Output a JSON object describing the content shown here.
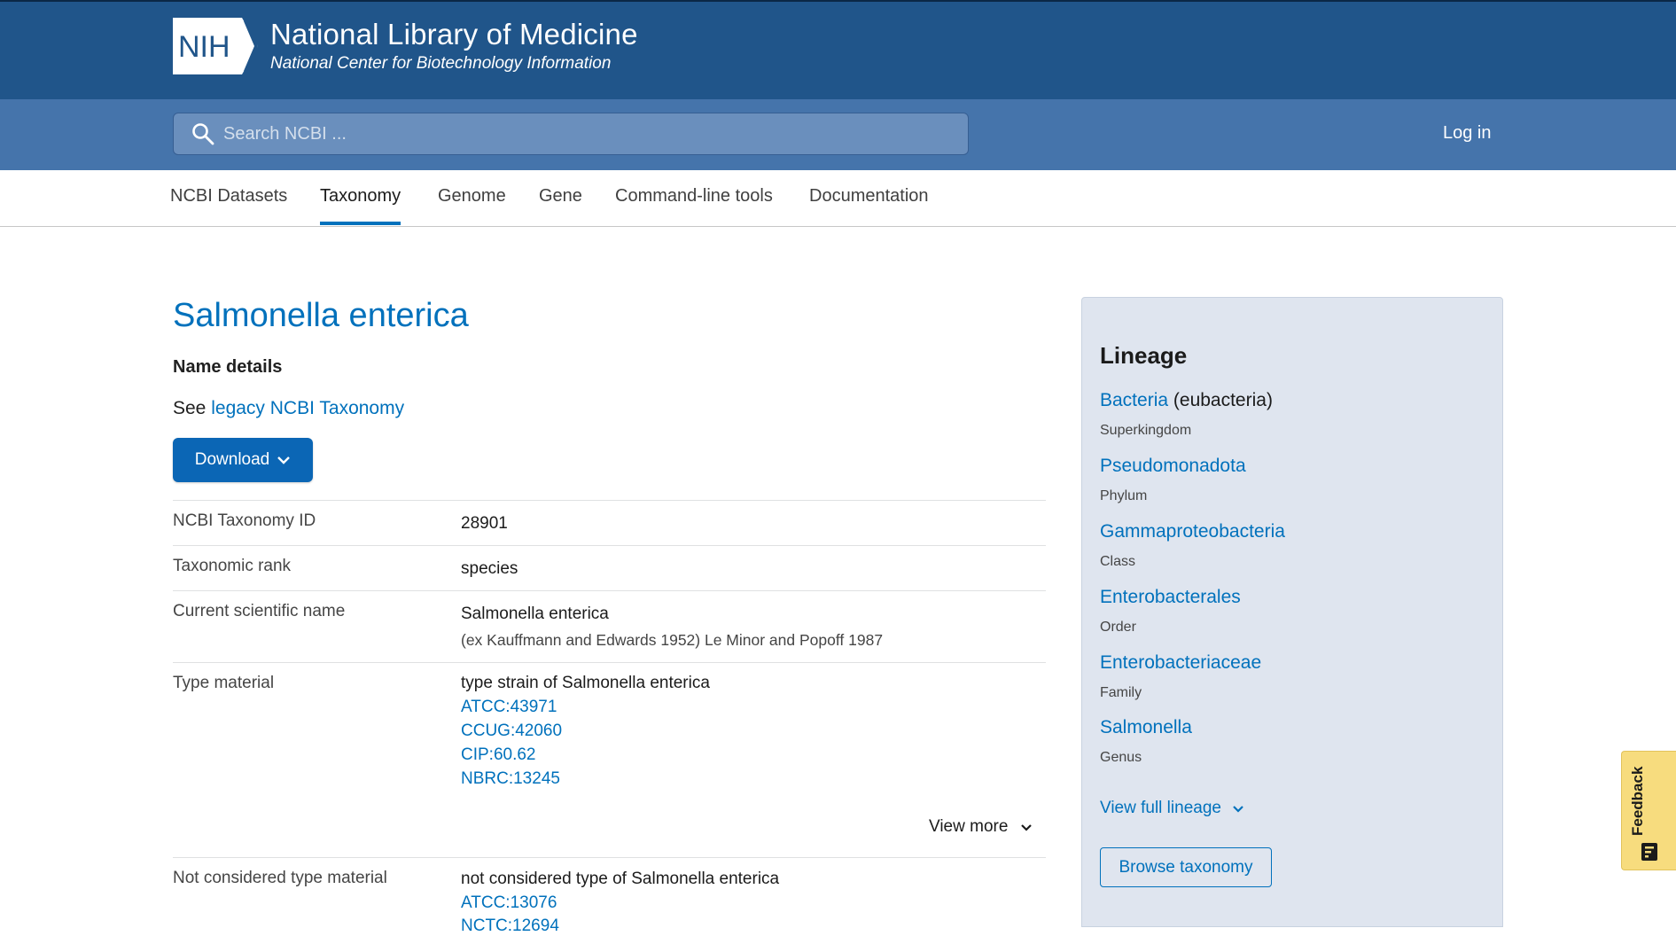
{
  "header": {
    "logo_text": "NIH",
    "title": "National Library of Medicine",
    "subtitle": "National Center for Biotechnology Information",
    "login_label": "Log in"
  },
  "search": {
    "placeholder": "Search NCBI ..."
  },
  "tabs": [
    {
      "label": "NCBI Datasets",
      "active": false
    },
    {
      "label": "Taxonomy",
      "active": true
    },
    {
      "label": "Genome",
      "active": false
    },
    {
      "label": "Gene",
      "active": false
    },
    {
      "label": "Command-line tools",
      "active": false
    },
    {
      "label": "Documentation",
      "active": false
    }
  ],
  "main": {
    "title": "Salmonella enterica",
    "name_details_heading": "Name details",
    "see_prefix": "See",
    "legacy_link": "legacy NCBI Taxonomy",
    "download_label": "Download",
    "details": {
      "taxonomy_id": {
        "label": "NCBI Taxonomy ID",
        "value": "28901"
      },
      "rank": {
        "label": "Taxonomic rank",
        "value": "species"
      },
      "scientific_name": {
        "label": "Current scientific name",
        "value": "Salmonella enterica",
        "authority": "(ex Kauffmann and Edwards 1952) Le Minor and Popoff 1987"
      },
      "type_material": {
        "label": "Type material",
        "value": "type strain of Salmonella enterica",
        "links": [
          "ATCC:43971",
          "CCUG:42060",
          "CIP:60.62",
          "NBRC:13245"
        ]
      },
      "view_more_label": "View more",
      "not_type_material": {
        "label": "Not considered type material",
        "value": "not considered type of Salmonella enterica",
        "links": [
          "ATCC:13076",
          "NCTC:12694"
        ]
      }
    }
  },
  "lineage": {
    "heading": "Lineage",
    "items": [
      {
        "name": "Bacteria",
        "common": "(eubacteria)",
        "rank": "Superkingdom"
      },
      {
        "name": "Pseudomonadota",
        "common": "",
        "rank": "Phylum"
      },
      {
        "name": "Gammaproteobacteria",
        "common": "",
        "rank": "Class"
      },
      {
        "name": "Enterobacterales",
        "common": "",
        "rank": "Order"
      },
      {
        "name": "Enterobacteriaceae",
        "common": "",
        "rank": "Family"
      },
      {
        "name": "Salmonella",
        "common": "",
        "rank": "Genus"
      }
    ],
    "view_full_label": "View full lineage",
    "browse_label": "Browse taxonomy"
  },
  "feedback": {
    "label": "Feedback"
  },
  "colors": {
    "header_bg": "#20558a",
    "search_bar_bg": "#4574ab",
    "link": "#0071bc",
    "primary_button": "#0b66b5",
    "lineage_panel_bg": "#dfe5ef",
    "feedback_bg": "#f7dc7e"
  }
}
